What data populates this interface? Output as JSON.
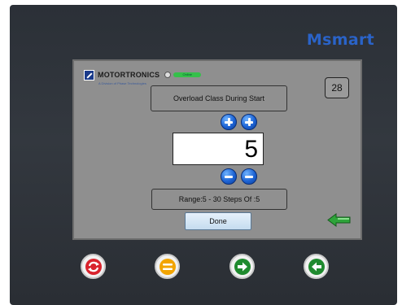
{
  "brand": {
    "name": "Msmart"
  },
  "screen": {
    "logo_text": "MOTORTRONICS",
    "logo_subtext": "A Division of Phase Technologies",
    "status_label": "Online",
    "page_number": "28",
    "parameter_title": "Overload Class During Start",
    "value": "5",
    "range_text": "Range:5 - 30   Steps Of  :5",
    "done_label": "Done"
  },
  "icons": {
    "increment": "plus-icon",
    "decrement": "minus-icon",
    "back": "arrow-left-icon"
  },
  "hardware_buttons": [
    {
      "icon": "refresh-icon",
      "color": "#d9232d"
    },
    {
      "icon": "menu-icon",
      "color": "#f2a400"
    },
    {
      "icon": "arrow-right-icon",
      "color": "#1f8a2e"
    },
    {
      "icon": "arrow-left-icon",
      "color": "#1f8a2e"
    }
  ],
  "colors": {
    "brand": "#2a63c8",
    "screen_bg": "#8f8f8f",
    "status_green": "#35c04a"
  }
}
